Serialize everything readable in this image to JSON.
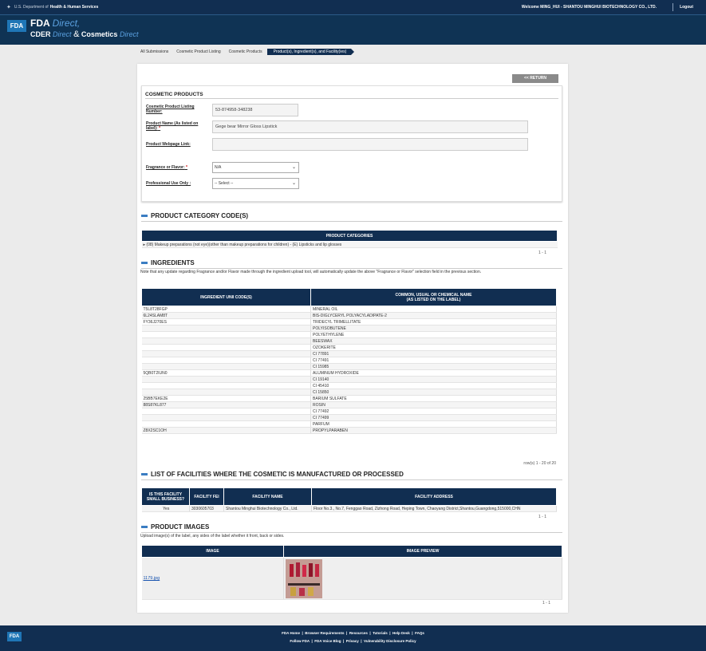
{
  "topbar": {
    "agency_prefix": "U.S. Department of",
    "agency": "Health & Human Services",
    "welcome": "Welcome MING_HUI - SHANTOU MINGHUI BIOTECHNOLOGY CO., LTD.",
    "logout": "Logout"
  },
  "header": {
    "logo": "FDA",
    "line1_bold": "FDA",
    "line1_italic": "Direct,",
    "line2_a": "CDER",
    "line2_a_italic": "Direct",
    "line2_amp": "&",
    "line2_b": "Cosmetics",
    "line2_b_italic": "Direct"
  },
  "breadcrumb": [
    "All Submissions",
    "Cosmetic Product Listing",
    "Cosmetic Products",
    "Product(s), Ingredient(s), and Facility(ies)"
  ],
  "return_button": "<< RETURN",
  "cosmetic_products": {
    "title": "COSMETIC PRODUCTS",
    "listing_number_label": "Cosmetic Product Listing Number:",
    "listing_number": "53-874958-348238",
    "product_name_label": "Product Name (As listed on label):",
    "product_name": "Gege bear Mirror Gloss Lipstick",
    "webpage_label": "Product Webpage Link:",
    "webpage": "",
    "fragrance_label": "Fragrance or Flavor:",
    "fragrance_value": "N/A",
    "professional_label": "Professional Use Only :",
    "professional_value": "-- Select --",
    "required_mark": "*"
  },
  "category_section": {
    "title": "PRODUCT CATEGORY CODE(S)",
    "header": "PRODUCT CATEGORIES",
    "item": "(08) Makeup preparations (not eye)(other than makeup preparations for children) - (E) Lipsticks and lip glosses",
    "pager": "1 - 1"
  },
  "ingredients": {
    "title": "INGREDIENTS",
    "note": "Note that any update regarding Fragrance and/or Flavor made through the ingredient upload tool, will automatically update the above \"Fragrance or Flavor\" selection field in the previous section.",
    "col1": "INGREDIENT UNII CODE(S)",
    "col2_line1": "COMMON, USUAL OR CHEMICAL NAME",
    "col2_line2": "(AS LISTED ON THE LABEL)",
    "rows": [
      [
        "T5L8T28FGP",
        "MINERAL OIL"
      ],
      [
        "6L24SLAM8T",
        "BIS-DIGLYCERYL POLYACYLADIPATE-2"
      ],
      [
        "FY36J270ES",
        "TRIDECYL TRIMELLITATE"
      ],
      [
        "",
        "POLYISOBUTENE"
      ],
      [
        "",
        "POLYETHYLENE"
      ],
      [
        "",
        "BEESWAX"
      ],
      [
        "",
        "OZOKERITE"
      ],
      [
        "",
        "CI 77891"
      ],
      [
        "",
        "CI 77491"
      ],
      [
        "",
        "CI 15985"
      ],
      [
        "5QB0T2IUN0",
        "ALUMINUM HYDROXIDE"
      ],
      [
        "",
        "CI 19140"
      ],
      [
        "",
        "CI 45410"
      ],
      [
        "",
        "CI 15850"
      ],
      [
        "25BB7EKE2E",
        "BARIUM SULFATE"
      ],
      [
        "88S87KL877",
        "ROSIN"
      ],
      [
        "",
        "CI 77492"
      ],
      [
        "",
        "CI 77499"
      ],
      [
        "",
        "PARFUM"
      ],
      [
        "Z8X2SC1OH",
        "PROPYLPARABEN"
      ]
    ],
    "pager": "row(s) 1 - 20 of 20"
  },
  "facilities": {
    "title": "LIST OF FACILITIES WHERE THE COSMETIC IS MANUFACTURED OR PROCESSED",
    "col1_line1": "IS THIS FACILITY",
    "col1_line2": "SMALL BUSINESS?",
    "col2": "FACILITY FEI",
    "col3": "FACILITY NAME",
    "col4": "FACILITY ADDRESS",
    "row": {
      "small": "Yes",
      "fei": "3030605703",
      "name": "Shantou Minghui Biotechnology Co., Ltd.",
      "address": "Floor No.3., No.7, Fenggao Road, Zizhong Road, Heping Town, Chaoyang District,Shantou,Guangdong,515000,CHN"
    },
    "pager": "1 - 1"
  },
  "images": {
    "title": "PRODUCT IMAGES",
    "note": "Upload image(s) of the label, any sides of the label whether it front, back or sides.",
    "col1": "IMAGE",
    "col2": "IMAGE PREVIEW",
    "file": "1179.jpg",
    "pager": "1 - 1"
  },
  "footer": {
    "logo": "FDA",
    "links1": [
      "FDA Home",
      "Browser Requirements",
      "Resources",
      "Tutorials",
      "Help Desk",
      "FAQs"
    ],
    "links2": [
      "Follow FDA",
      "FDA Voice Blog",
      "Privacy",
      "Vulnerability Disclosure Policy"
    ]
  }
}
